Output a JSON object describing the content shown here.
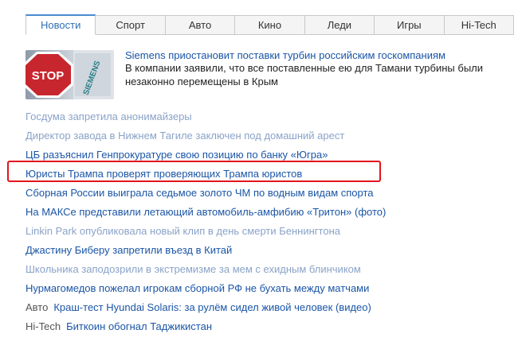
{
  "tabs": [
    {
      "label": "Новости",
      "active": true
    },
    {
      "label": "Спорт",
      "active": false
    },
    {
      "label": "Авто",
      "active": false
    },
    {
      "label": "Кино",
      "active": false
    },
    {
      "label": "Леди",
      "active": false
    },
    {
      "label": "Игры",
      "active": false
    },
    {
      "label": "Hi-Tech",
      "active": false
    }
  ],
  "feature": {
    "title": "Siemens приостановит поставки турбин российским госкомпаниям",
    "description": "В компании заявили, что все поставленные ею для Тамани турбины были незаконно перемещены в Крым",
    "image": {
      "sign_text": "STOP",
      "brand_text": "SIEMENS"
    }
  },
  "news": [
    {
      "text": "Госдума запретила анонимайзеры",
      "style": "visited"
    },
    {
      "text": "Директор завода в Нижнем Тагиле заключен под домашний арест",
      "style": "visited"
    },
    {
      "text": "ЦБ разъяснил Генпрокуратуре свою позицию по банку «Югра»",
      "style": "fresh"
    },
    {
      "text": "Юристы Трампа проверят проверяющих Трампа юристов",
      "style": "fresh",
      "highlighted": true
    },
    {
      "text": "Сборная России выиграла седьмое золото ЧМ по водным видам спорта",
      "style": "fresh"
    },
    {
      "text": "На МАКСе представили летающий автомобиль-амфибию «Тритон» (фото)",
      "style": "fresh"
    },
    {
      "text": "Linkin Park опубликовала новый клип в день смерти Беннингтона",
      "style": "visited"
    },
    {
      "text": "Джастину Биберу запретили въезд в Китай",
      "style": "fresh"
    },
    {
      "text": "Школьника заподозрили в экстремизме за мем с ехидным блинчиком",
      "style": "visited"
    },
    {
      "text": "Нурмагомедов пожелал игрокам сборной РФ не бухать между матчами",
      "style": "fresh"
    },
    {
      "category": "Авто",
      "text": "Краш-тест Hyundai Solaris: за рулём сидел живой человек (видео)",
      "style": "fresh"
    },
    {
      "category": "Hi-Tech",
      "text": "Биткоин обогнал Таджикистан",
      "style": "fresh"
    }
  ],
  "colors": {
    "link": "#1a55a6",
    "visited_link": "#8aa3c8",
    "active_tab_text": "#2f6fb5",
    "highlight_border": "#e3141c"
  }
}
